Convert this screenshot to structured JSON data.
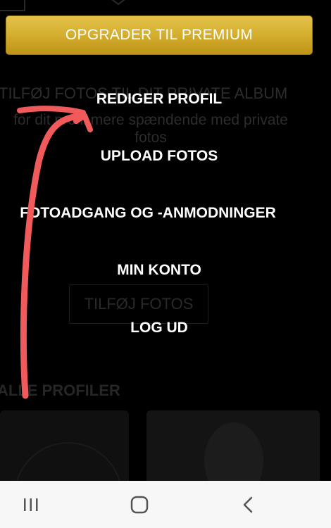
{
  "background": {
    "album_title": "TILFØJ FOTOS TIL DIT PRIVATE ALBUM",
    "album_description": "for dit profil mere spændende med private fotos",
    "add_photos_label": "TILFØJ FOTOS",
    "profiles_title": "ALLE PROFILER"
  },
  "premium_button": {
    "label": "OPGRADER TIL PREMIUM",
    "color": "#d6b030"
  },
  "menu": {
    "items": [
      {
        "label": "REDIGER PROFIL"
      },
      {
        "label": "UPLOAD FOTOS"
      },
      {
        "label": "FOTOADGANG OG -ANMODNINGER"
      },
      {
        "label": "MIN KONTO"
      },
      {
        "label": "LOG UD"
      }
    ]
  },
  "annotation": {
    "type": "arrow",
    "color": "#f05a5a",
    "points_to": "REDIGER PROFIL"
  },
  "navbar": {
    "recents_icon": "recents-icon",
    "home_icon": "home-icon",
    "back_icon": "back-icon"
  }
}
